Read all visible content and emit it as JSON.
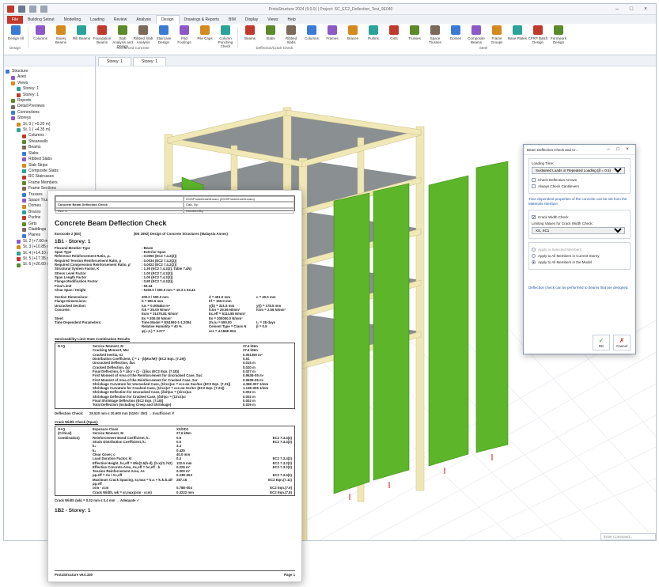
{
  "window": {
    "title": "ProtaStructure 2024 (9.0.0) | Project: SC_EC2_Deflection_Test_9E040"
  },
  "ribbon": {
    "tabs": [
      "File",
      "Building Setout",
      "Modelling",
      "Loading",
      "Review",
      "Analysis",
      "Design",
      "Drawings & Reports",
      "BIM",
      "Display",
      "Views",
      "Help"
    ],
    "buttons": [
      "Design All",
      "Columns",
      "Storey Beams",
      "Rib Beams",
      "Foundation Beams",
      "Slab Analysis and Design",
      "Ribbed Slab Analysis",
      "Staircase Design",
      "Pad Footings",
      "Pile Caps",
      "Column Punching Check",
      "Beams",
      "Slabs",
      "Ribbed Slabs",
      "Columns",
      "Frames",
      "Braces",
      "Purlins",
      "Girts",
      "Trusses",
      "Space Trusses",
      "Domes",
      "Composite Beams",
      "Frame Groups",
      "Base Plates",
      "CFRP Batch Design",
      "Formwork Design"
    ],
    "groups": [
      "Design",
      "Reinforced Concrete",
      "Deflection/Crack Check",
      "Steel"
    ]
  },
  "viewport": {
    "tab": "Storey: 1",
    "command_placeholder": "Enter Command..."
  },
  "tree": [
    {
      "label": "Structure",
      "ind": 0
    },
    {
      "label": "Axes",
      "ind": 1
    },
    {
      "label": "Views",
      "ind": 1
    },
    {
      "label": "Storey: 1",
      "ind": 2
    },
    {
      "label": "Storey: 1",
      "ind": 2
    },
    {
      "label": "Reports",
      "ind": 1
    },
    {
      "label": "Detail Previews",
      "ind": 1
    },
    {
      "label": "Connections",
      "ind": 1
    },
    {
      "label": "Storeys",
      "ind": 1
    },
    {
      "label": "St. 0 ( +0.20 m)",
      "ind": 2
    },
    {
      "label": "St. 1 ( +4.35 m)",
      "ind": 2
    },
    {
      "label": "Columns",
      "ind": 3
    },
    {
      "label": "Shearwalls",
      "ind": 3
    },
    {
      "label": "Beams",
      "ind": 3
    },
    {
      "label": "Slabs",
      "ind": 3
    },
    {
      "label": "Ribbed Slabs",
      "ind": 3
    },
    {
      "label": "Slab Strips",
      "ind": 3
    },
    {
      "label": "Composite Slabs",
      "ind": 3
    },
    {
      "label": "RC Staircases",
      "ind": 3
    },
    {
      "label": "Frame Members",
      "ind": 3
    },
    {
      "label": "Frame Sections",
      "ind": 3
    },
    {
      "label": "Trusses",
      "ind": 3
    },
    {
      "label": "Space Trusses",
      "ind": 3
    },
    {
      "label": "Domes",
      "ind": 3
    },
    {
      "label": "Braces",
      "ind": 3
    },
    {
      "label": "Purlins",
      "ind": 3
    },
    {
      "label": "Girts",
      "ind": 3
    },
    {
      "label": "Claddings",
      "ind": 3
    },
    {
      "label": "Planes",
      "ind": 3
    },
    {
      "label": "St. 2 (+7.60 m)",
      "ind": 2
    },
    {
      "label": "St. 3 (+10.85 m)",
      "ind": 2
    },
    {
      "label": "St. 4 (+14.10 m)",
      "ind": 2
    },
    {
      "label": "St. 5 (+17.35 m)",
      "ind": 2
    },
    {
      "label": "St. 6 (+20.60 m)",
      "ind": 2
    }
  ],
  "report": {
    "project": "2020ProtaDesteliLizaro (2020ProtaDesteliLizaro)",
    "header_left": "Concrete Beam Deflection Check",
    "rev": "Rev: 1",
    "calc_by": "Calc. By:",
    "checked_by": "Checked By:",
    "title": "Concrete Beam Deflection Check",
    "code_left": "Eurocode 2 (BS)",
    "code_right": "(EN 1992) Design of Concrete Structures (Malaysia Annex)",
    "beam_heading": "1B1 - Storey: 1",
    "props": [
      [
        "Flexural Member Type",
        ": Beam"
      ],
      [
        "Span Type",
        ": Exterior Span"
      ],
      [
        "Reference Reinforcement Ratio, ρ₀",
        ": 0.0050  (EC2 7.4.2(2))"
      ],
      [
        "Required Tension Reinforcement Ratio, ρ",
        ": 0.0034  (EC2 7.4.2(2))"
      ],
      [
        "Required Compression Reinforcement Ratio, ρ'",
        ": 0.0022  (EC2 7.4.2(2))"
      ],
      [
        "Structural System Factor, K",
        ": 1.30  (EC2 7.4.2(2), Table 7.4N)"
      ],
      [
        "Stress Level Factor",
        ": 1.00  (EC2 7.4.2(2))"
      ],
      [
        "Span Length Factor",
        ": 1.00  (EC2 7.4.2(2))"
      ],
      [
        "Flange Modification Factor",
        ": 0.80  (EC2 7.4.2(2))"
      ],
      [
        "Final Limit",
        ": 53.44"
      ],
      [
        "Clear Span / Height",
        ": 5150.0 / 500.0 mm  =  10.3 ≤ 53.44"
      ]
    ],
    "section": [
      [
        "Section Dimensions:",
        "200.0 / 500.0 mm",
        "d = 451.0 mm",
        "c = 40.0 mm"
      ],
      [
        "Flange Dimensions:",
        "b = 900.5 mm",
        "hf = 150.0 mm",
        ""
      ],
      [
        "Uncracked Section:",
        "Iuc = 0.005464 m⁴",
        "y(b) = 321.5 mm",
        "y(t) = 178.5 mm"
      ],
      [
        "Concrete:",
        "fck = 25.00 N/mm²",
        "fctm = 25.56 N/mm²",
        "fctm = 2.56 N/mm²"
      ],
      [
        "",
        "Ecm = 31475.81 N/mm²",
        "Ec,eff = 5114.85 N/mm²",
        ""
      ],
      [
        "Steel:",
        "Es = 200.00 N/mm²",
        "Es = 200000.0 N/mm²",
        ""
      ],
      [
        "Time Dependent Parameters:",
        "Time Model = EN1992-1-1:2004",
        "2h₀/u = 590.00",
        "t₀ = 28 days"
      ],
      [
        "",
        "Relative Humidity = 40 %",
        "Cement Type = Class N",
        "β = 0.5"
      ],
      [
        "",
        "φ(∞,t₀) = 3.277",
        "εcs = 4.184E-004",
        ""
      ]
    ],
    "sls_heading": "Serviceability Limit State Combination Results",
    "sls_combo": "G+Q",
    "sls": [
      [
        "Service Moment, M",
        "27.6 kNm"
      ],
      [
        "Cracking Moment, Mcr",
        "27.6 kNm"
      ],
      [
        "Cracked Inertia, Icr",
        "0.001350 m⁴"
      ],
      [
        "Distribution Coefficient, ζ = 1 - β(Mcr/M)² (EC2 Eqn. (7.19))",
        "0.51"
      ],
      [
        "Uncracked Deflection, δuc",
        "0.015 m"
      ],
      [
        "Cracked Deflection, δcr",
        "0.020 m"
      ],
      [
        "Final Deflection, δ = ζδcr + (1 - ζ)δuc (EC2 Eqn. (7.18))",
        "0.027 m"
      ],
      [
        "First Moment of Area of the Reinforcement for Uncracked Case, Suc",
        "0.963E-05 m³"
      ],
      [
        "First Moment of Area of the Reinforcement for Cracked Case, Scr",
        "0.963E-05 m³"
      ],
      [
        "Shrinkage Curvature for Uncracked Case, (1/rcs)uc = εcs·αe·Suc/Iuc (EC2 Eqn. (7.21))",
        "4.36E-007 1/mm"
      ],
      [
        "Shrinkage Curvature for Cracked Case, (1/rcs)cr = εcs·αe·Scr/Icr (EC2 Eqn. (7.21))",
        "1.13E-006 1/mm"
      ],
      [
        "Shrinkage Deflection for Uncracked Case, (δsh)uc = (1/rcs)uc",
        "0.002 m"
      ],
      [
        "Shrinkage Deflection for Cracked Case, (δsh)cr = (1/rcs)cr",
        "0.002 m"
      ],
      [
        "Final Shrinkage Deflection (EC2 Eqn. (7.18))",
        "0.002 m"
      ],
      [
        "Total Deflection (Including Creep and Shrinkage)",
        "0.029 m"
      ]
    ],
    "deflection_check": "Deflection Check:",
    "deflection_result": "28.520 mm ≤ 20.600 mm (5150 / 250)  →  Insufficient  ✗",
    "crack_heading": "Crack Width Check (Span):",
    "crack": [
      [
        "G+Q",
        "Exposure Class",
        "XS/XD1",
        ""
      ],
      [
        "(Critical)",
        "Service Moment, M",
        "27.6 kNm",
        ""
      ],
      [
        "Combination)",
        "Reinforcement Bond Coefficient, k₁",
        "0.8",
        "EC2 7.3.4(3)"
      ],
      [
        "",
        "Strain Distribution Coefficient, k₂",
        "0.5",
        "EC2 7.3.4(3)"
      ],
      [
        "",
        "k₃",
        "3.4",
        ""
      ],
      [
        "",
        "k₄",
        "0.425",
        ""
      ],
      [
        "",
        "Clear Cover, c",
        "40.0 mm",
        ""
      ],
      [
        "",
        "Load Duration Factor, kt",
        "0.4",
        "EC2 7.3.4(2)"
      ],
      [
        "",
        "Effective Height, hc,eff = Min(2.5(h-d), (h-x)/3, h/2)",
        "122.5 mm",
        "EC2 7.3.2(3)"
      ],
      [
        "",
        "Effective Concrete Area, Ac,eff = hc,eff · b",
        "0.025 m²",
        "EC2 7.3.2(3)"
      ],
      [
        "",
        "Tension Reinforcement Area, As",
        "0.000 m²",
        ""
      ],
      [
        "",
        "ρp,eff = As / Ac,eff",
        "0.23E-003",
        "EC2 7.3.4(2)"
      ],
      [
        "",
        "Maximum Crack Spacing, sr,max = k₃c + k₁k₂k₄Ø/ρp,eff",
        "287.16",
        "EC2 Eqn.(7.11)"
      ],
      [
        "",
        "εsm - εcm",
        "0.78E-004",
        "EC2 Eqn.(7.9)"
      ],
      [
        "",
        "Crack Width, wk = sr,max(εsm - εcm)",
        "0.3222 mm",
        "EC2 Eqn.(7.8)"
      ]
    ],
    "crack_result": "Crack Width (wk) = 0.32 mm ≤ 0.4 mm → Adequate ✓",
    "next_heading": "1B2 - Storey: 1",
    "footer_left": "ProtaStructure v9.0.330",
    "footer_right": "Page 1"
  },
  "dialog": {
    "title": "Beam Deflection Check and Cr...",
    "loading_label": "Loading Time:",
    "loading_value": "Sustained Loads or Repeated Loading (β = 0.5)",
    "opt_arrows": "Check Deflection Arrows",
    "opt_cantilevers": "Always Check Cantilevers",
    "time_note": "Time dependent properties of the concrete can be set from the Materials interface.",
    "crack_label": "Crack Width Check",
    "limit_label": "Limiting Values for Crack Width Check:",
    "limit_value": "XS, XC1",
    "radio1": "Apply to Selected Members",
    "radio2": "Apply to All Members in Current Storey",
    "radio3": "Apply to All Members in the Model",
    "bottom_note": "Deflection check can be performed to beams that are designed.",
    "ok": "OK",
    "cancel": "Cancel"
  }
}
